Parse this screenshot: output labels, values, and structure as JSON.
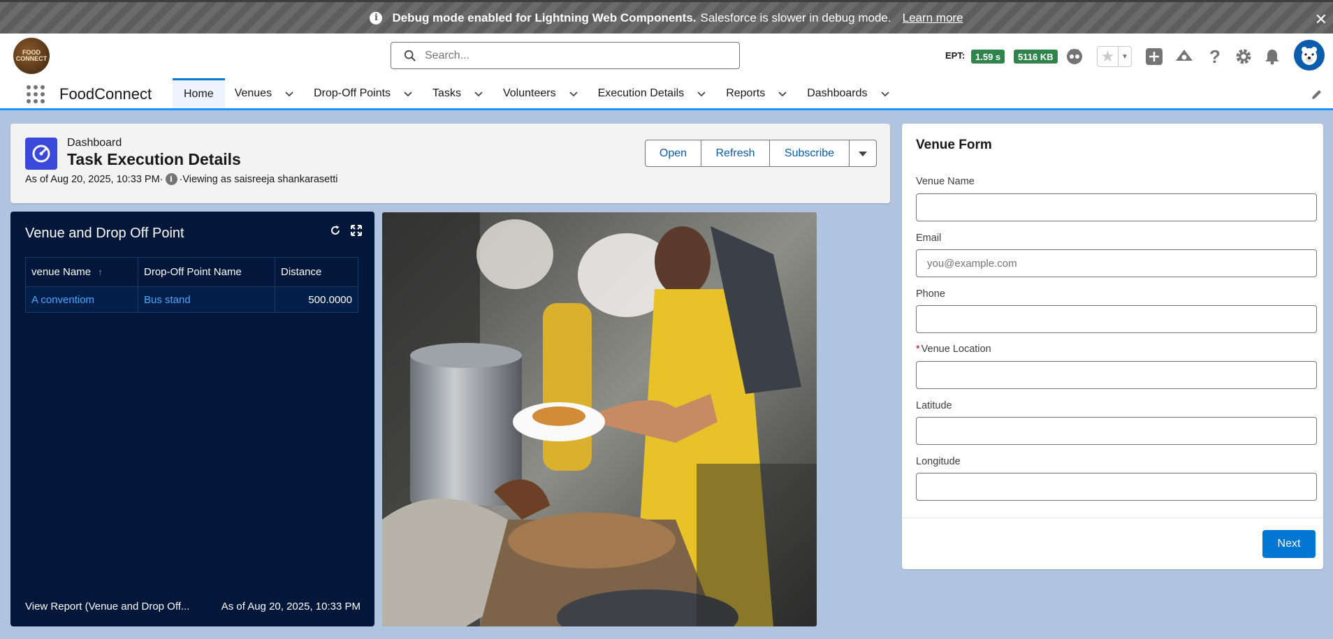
{
  "debug_banner": {
    "bold_text": "Debug mode enabled for Lightning Web Components.",
    "text": "Salesforce is slower in debug mode.",
    "link": "Learn more"
  },
  "header": {
    "logo_text": [
      "FOOD",
      "CONNECT"
    ],
    "search_placeholder": "Search...",
    "ept_label": "EPT:",
    "ept_value": "1.59 s",
    "memory_value": "5116 KB"
  },
  "nav": {
    "app_name": "FoodConnect",
    "items": [
      {
        "label": "Home",
        "active": true
      },
      {
        "label": "Venues"
      },
      {
        "label": "Drop-Off Points"
      },
      {
        "label": "Tasks"
      },
      {
        "label": "Volunteers"
      },
      {
        "label": "Execution Details"
      },
      {
        "label": "Reports"
      },
      {
        "label": "Dashboards"
      }
    ]
  },
  "dashboard": {
    "type_label": "Dashboard",
    "title": "Task Execution Details",
    "as_of": "As of Aug 20, 2025, 10:33 PM·",
    "viewing_as": "·Viewing as saisreeja shankarasetti",
    "buttons": {
      "open": "Open",
      "refresh": "Refresh",
      "subscribe": "Subscribe"
    }
  },
  "chart_panel": {
    "title": "Venue and Drop Off Point",
    "columns": [
      "venue Name",
      "Drop-Off Point Name",
      "Distance"
    ],
    "rows": [
      [
        "A conventiom",
        "Bus stand",
        "500.0000"
      ]
    ],
    "footer_link": "View Report (Venue and Drop Off...",
    "footer_date": "As of Aug 20, 2025, 10:33 PM"
  },
  "venue_form": {
    "title": "Venue Form",
    "fields": [
      {
        "label": "Venue Name",
        "value": "",
        "placeholder": ""
      },
      {
        "label": "Email",
        "value": "",
        "placeholder": "you@example.com"
      },
      {
        "label": "Phone",
        "value": "",
        "placeholder": ""
      },
      {
        "label": "Venue Location",
        "value": "",
        "placeholder": "",
        "required": true
      },
      {
        "label": "Latitude",
        "value": "",
        "placeholder": ""
      },
      {
        "label": "Longitude",
        "value": "",
        "placeholder": ""
      }
    ],
    "next_label": "Next"
  },
  "colors": {
    "brand": "#0176d3",
    "dashboard_icon": "#3a49da",
    "dark_panel": "#021739",
    "ept_badge": "#2e844a"
  }
}
